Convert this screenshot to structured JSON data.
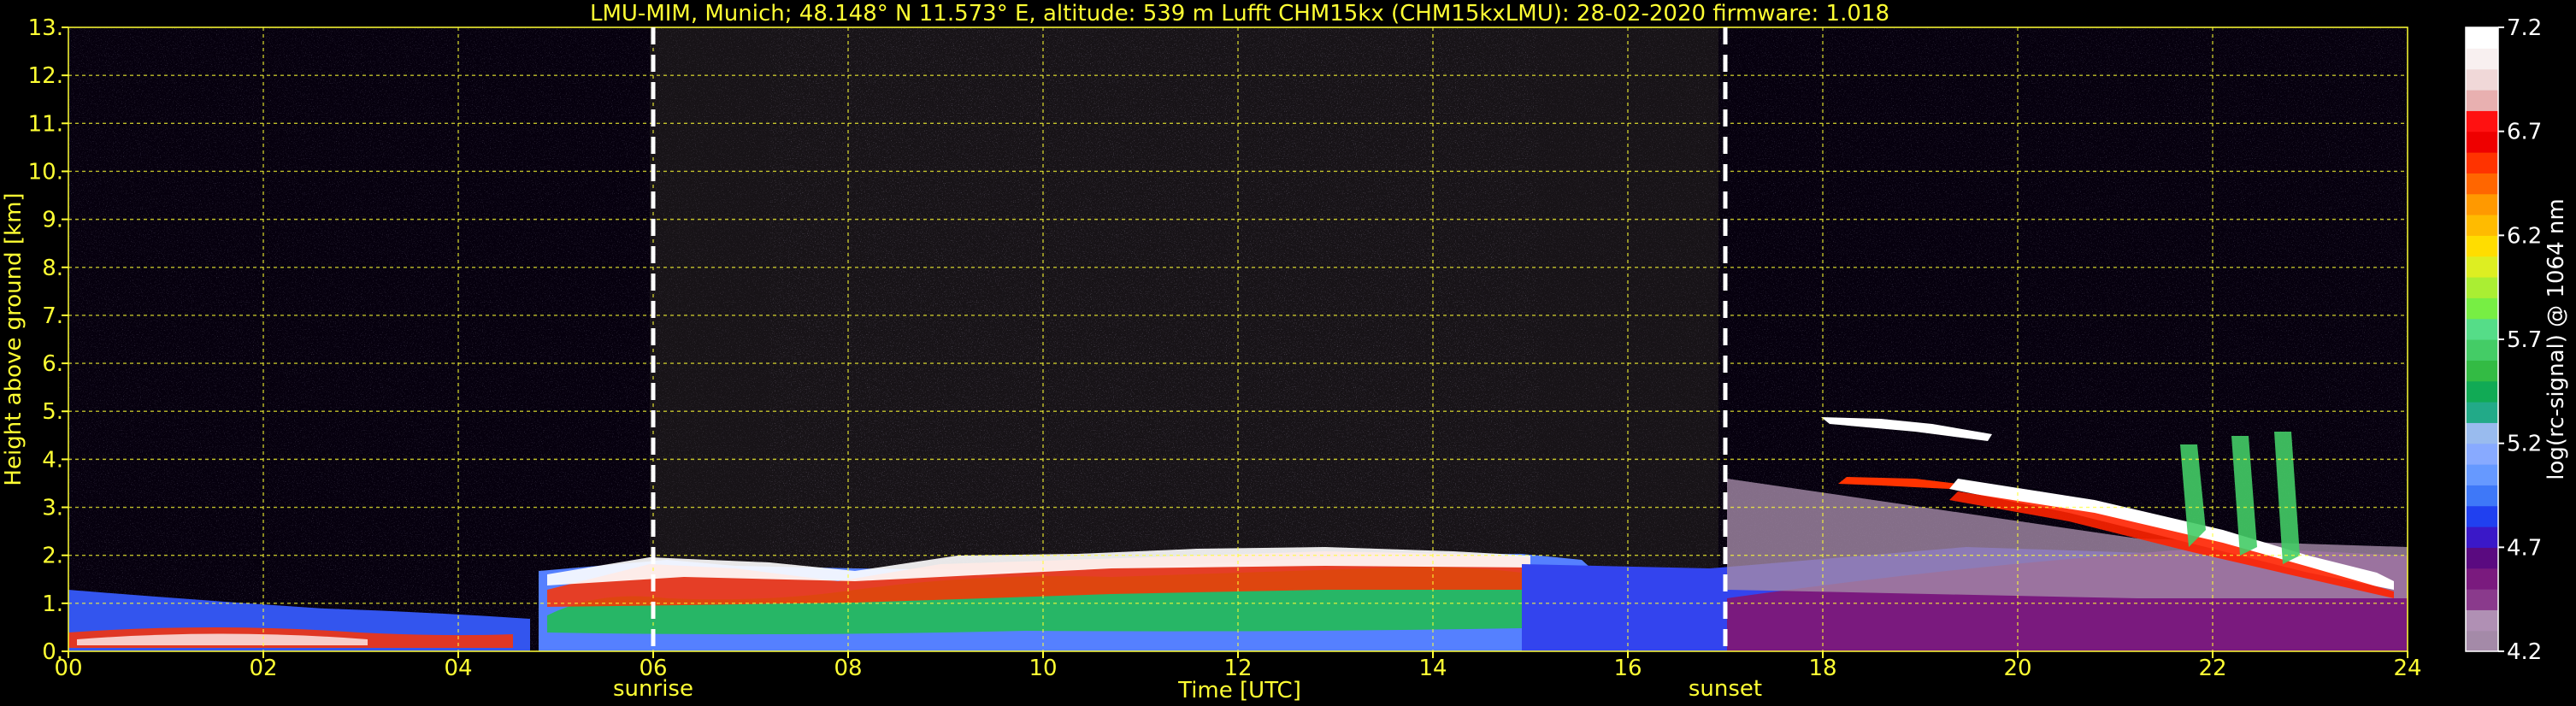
{
  "chart_data": {
    "type": "heatmap",
    "title": "LMU-MIM, Munich; 48.148° N 11.573° E, altitude: 539 m     Lufft CHM15kx (CHM15kxLMU): 28-02-2020     firmware: 1.018",
    "xlabel": "Time [UTC]",
    "ylabel": "Height above ground [km]",
    "xlim": [
      0,
      24
    ],
    "ylim": [
      0,
      13
    ],
    "x_ticks": [
      "00",
      "02",
      "04",
      "06",
      "08",
      "10",
      "12",
      "14",
      "16",
      "18",
      "20",
      "22",
      "24"
    ],
    "y_ticks": [
      "0.",
      "1.",
      "2.",
      "3.",
      "4.",
      "5.",
      "6.",
      "7.",
      "8.",
      "9.",
      "10.",
      "11.",
      "12.",
      "13."
    ],
    "grid": true,
    "markers": [
      {
        "label": "sunrise",
        "time": 6.0
      },
      {
        "label": "sunset",
        "time": 17.0
      }
    ],
    "colorbar": {
      "label": "log(rc-signal) @ 1064 nm",
      "range": [
        4.2,
        7.2
      ],
      "ticks": [
        "7.2",
        "6.7",
        "6.2",
        "5.7",
        "5.2",
        "4.7",
        "4.2"
      ],
      "colors": [
        "#a48aa8",
        "#b090b4",
        "#8a3a8c",
        "#7a1a7e",
        "#5a0a80",
        "#3a18c8",
        "#2040f0",
        "#3e78f8",
        "#6699ff",
        "#88aaff",
        "#99bbee",
        "#22aa88",
        "#11aa55",
        "#33bb44",
        "#44cc66",
        "#55dd88",
        "#77ee44",
        "#aaee33",
        "#ddee22",
        "#ffdd00",
        "#ffbb00",
        "#ff9900",
        "#ff6600",
        "#ff3300",
        "#ee0000",
        "#ff1111",
        "#e8b0b0",
        "#f0d8d8",
        "#f8f0f0",
        "#ffffff"
      ]
    }
  }
}
